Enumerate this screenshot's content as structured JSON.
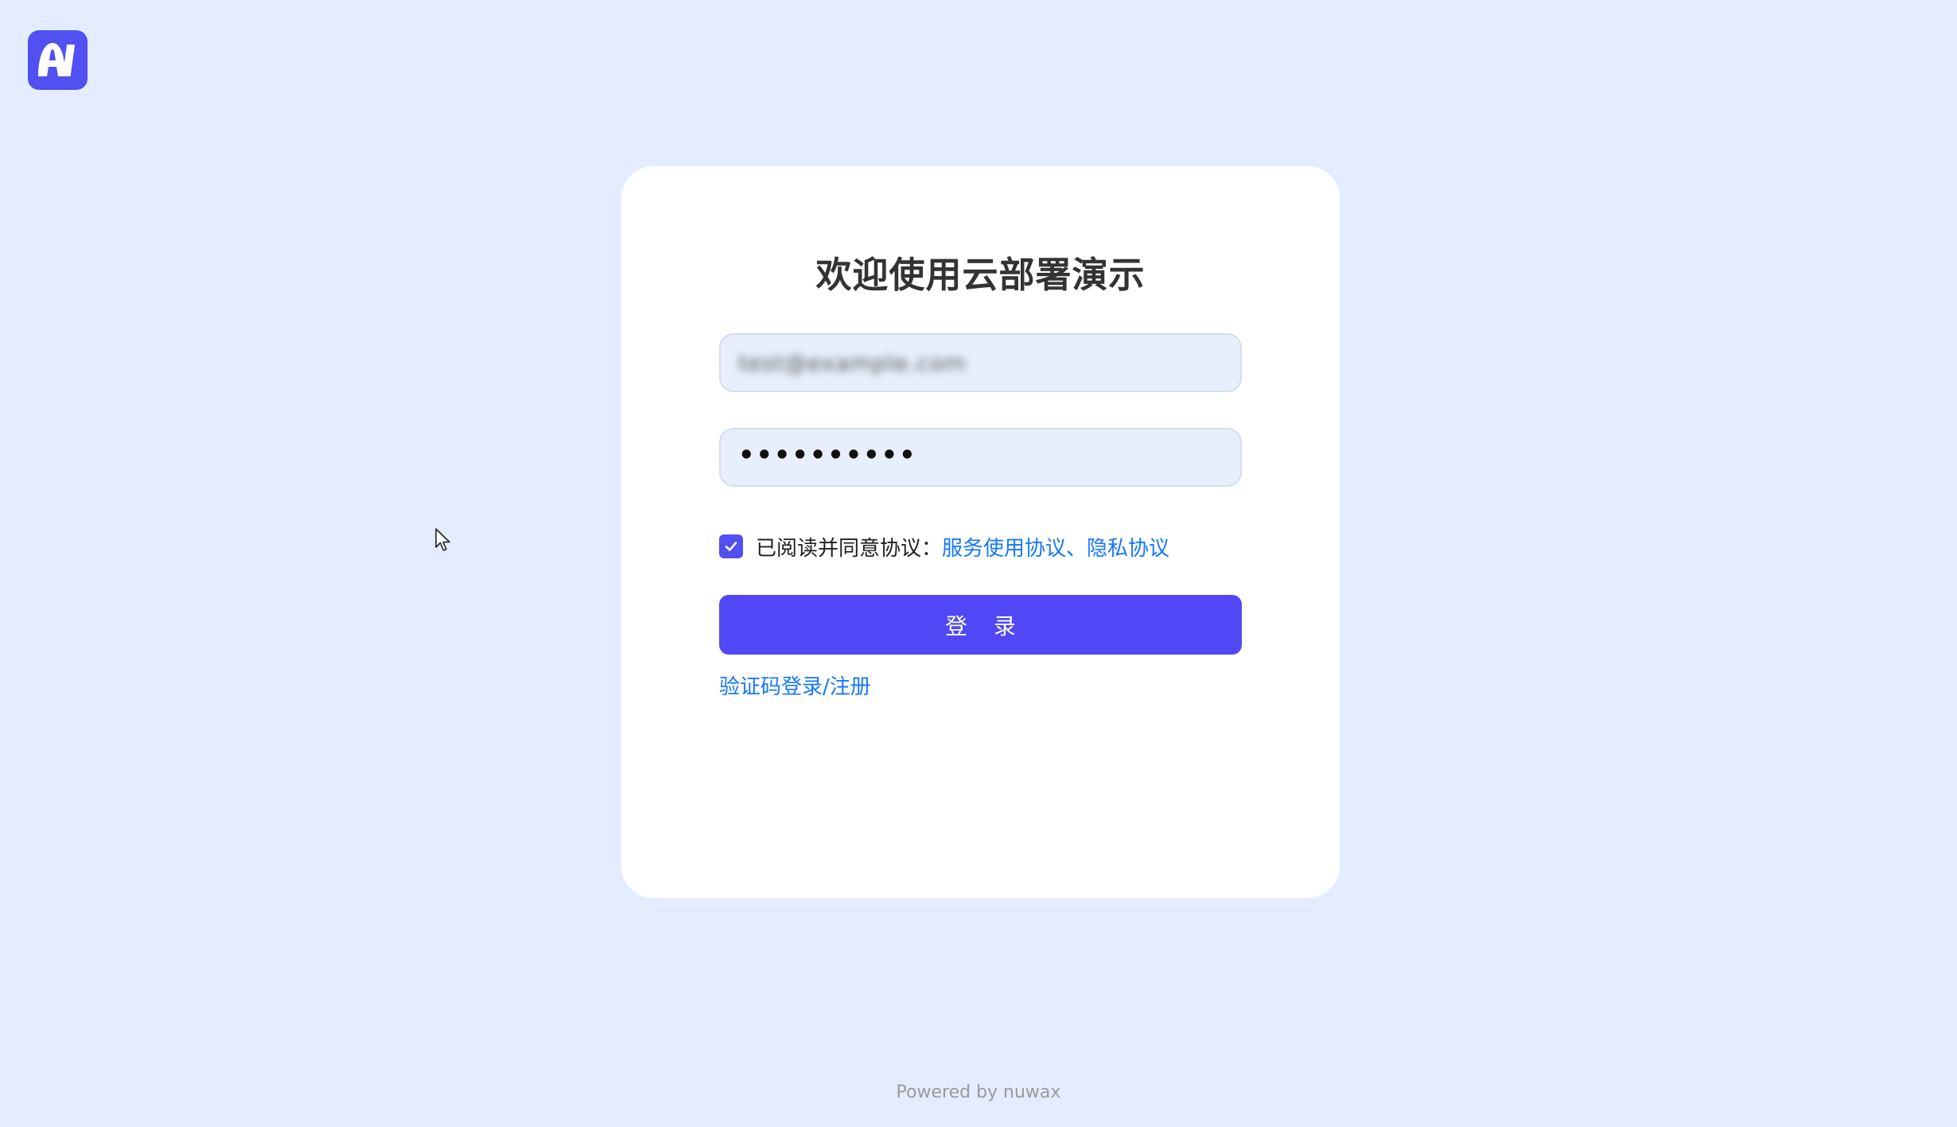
{
  "brand": {
    "logo_icon": "ai-logo-icon",
    "accent_color": "#5150f0"
  },
  "login": {
    "title": "欢迎使用云部署演示",
    "email_value": "test@example.com",
    "password_value": "••••••••••",
    "agreement_checked": true,
    "agreement_prefix": "已阅读并同意协议：",
    "agreement_links": "服务使用协议、隐私协议",
    "submit_label": "登 录",
    "alt_login_link": "验证码登录/注册"
  },
  "footer": {
    "text": "Powered by nuwax"
  }
}
